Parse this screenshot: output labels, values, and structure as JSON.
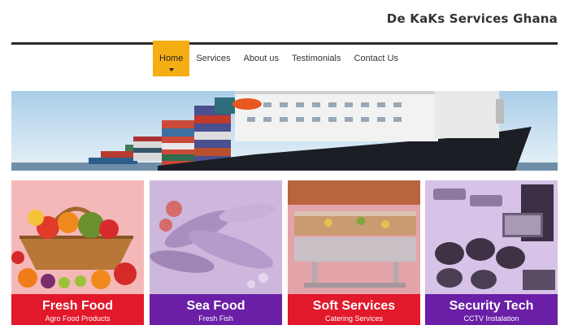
{
  "header": {
    "brand": "De KaKs Services Ghana"
  },
  "nav": {
    "items": [
      {
        "label": "Home",
        "active": true
      },
      {
        "label": "Services"
      },
      {
        "label": "About us"
      },
      {
        "label": "Testimonials"
      },
      {
        "label": "Contact Us"
      }
    ]
  },
  "hero": {
    "image": "cargo-ship-with-containers"
  },
  "cards": [
    {
      "title": "Fresh Food",
      "subtitle": "Agro Food Products",
      "image": "fruit-vegetable-basket",
      "band_color": "#e2182b"
    },
    {
      "title": "Sea Food",
      "subtitle": "Fresh Fish",
      "image": "fish-on-ice",
      "band_color": "#6a1fa6"
    },
    {
      "title": "Soft Services",
      "subtitle": "Catering Services",
      "image": "chafing-dishes",
      "band_color": "#e2182b"
    },
    {
      "title": "Security Tech",
      "subtitle": "CCTV Instalation",
      "image": "cctv-cameras",
      "band_color": "#6a1fa6"
    }
  ],
  "colors": {
    "nav_active": "#f6ad13",
    "red": "#e2182b",
    "purple": "#6a1fa6"
  }
}
